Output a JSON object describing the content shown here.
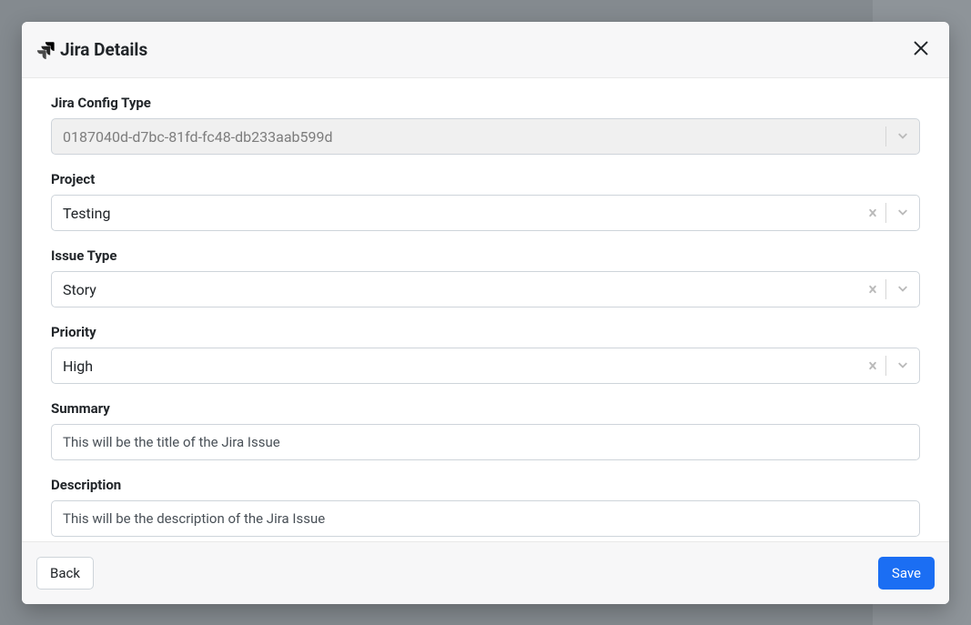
{
  "modal": {
    "title": "Jira Details",
    "fields": {
      "config_type": {
        "label": "Jira Config Type",
        "value": "0187040d-d7bc-81fd-fc48-db233aab599d"
      },
      "project": {
        "label": "Project",
        "value": "Testing"
      },
      "issue_type": {
        "label": "Issue Type",
        "value": "Story"
      },
      "priority": {
        "label": "Priority",
        "value": "High"
      },
      "summary": {
        "label": "Summary",
        "value": "This will be the title of the Jira Issue"
      },
      "description": {
        "label": "Description",
        "value": "This will be the description of the Jira Issue"
      }
    },
    "footer": {
      "back": "Back",
      "save": "Save"
    }
  }
}
